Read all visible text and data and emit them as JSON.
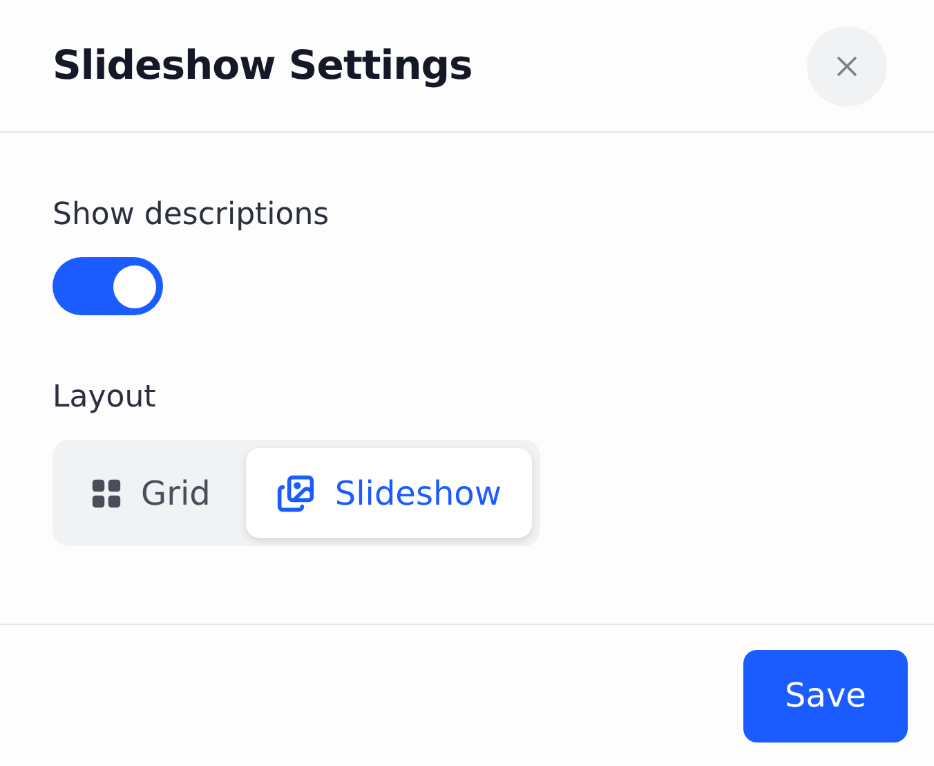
{
  "dialog": {
    "title": "Slideshow Settings"
  },
  "settings": [
    {
      "kind": "toggle",
      "label": "Show descriptions",
      "on": true
    },
    {
      "kind": "segmented",
      "label": "Layout",
      "options": [
        {
          "label": "Grid",
          "kind": "grid",
          "selected": false
        },
        {
          "label": "Slideshow",
          "kind": "images",
          "selected": true
        }
      ]
    }
  ],
  "footer": {
    "button": "Save"
  }
}
